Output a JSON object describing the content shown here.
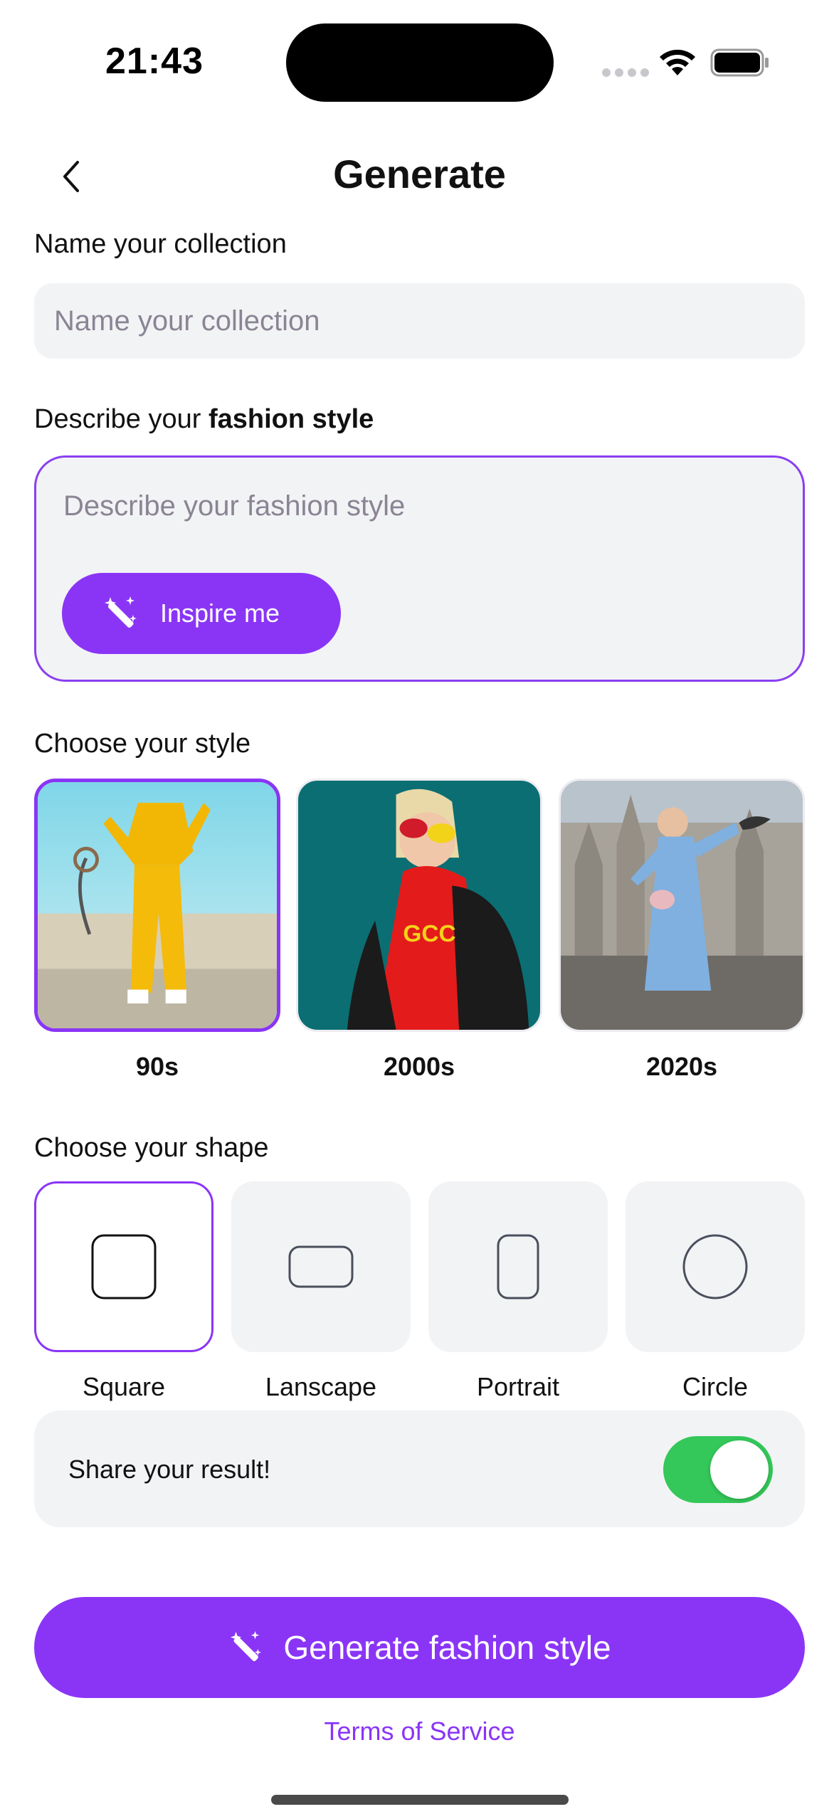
{
  "status_bar": {
    "time": "21:43"
  },
  "nav": {
    "title": "Generate"
  },
  "collection": {
    "label": "Name your collection",
    "placeholder": "Name your collection"
  },
  "description": {
    "label_prefix": "Describe your ",
    "label_bold": "fashion style",
    "placeholder": "Describe your fashion style",
    "inspire_label": "Inspire me"
  },
  "style_section": {
    "label": "Choose your style",
    "options": [
      {
        "label": "90s",
        "selected": true
      },
      {
        "label": "2000s",
        "selected": false
      },
      {
        "label": "2020s",
        "selected": false
      }
    ]
  },
  "shape_section": {
    "label": "Choose your shape",
    "options": [
      {
        "label": "Square",
        "icon": "square-shape-icon",
        "selected": true
      },
      {
        "label": "Lanscape",
        "icon": "landscape-shape-icon",
        "selected": false
      },
      {
        "label": "Portrait",
        "icon": "portrait-shape-icon",
        "selected": false
      },
      {
        "label": "Circle",
        "icon": "circle-shape-icon",
        "selected": false
      }
    ]
  },
  "share": {
    "label": "Share your result!",
    "enabled": true
  },
  "generate_button": {
    "label": "Generate fashion style"
  },
  "terms": {
    "label": "Terms of Service"
  },
  "colors": {
    "accent": "#8a35f6",
    "toggle_on": "#34c759",
    "field_bg": "#f2f3f5"
  }
}
